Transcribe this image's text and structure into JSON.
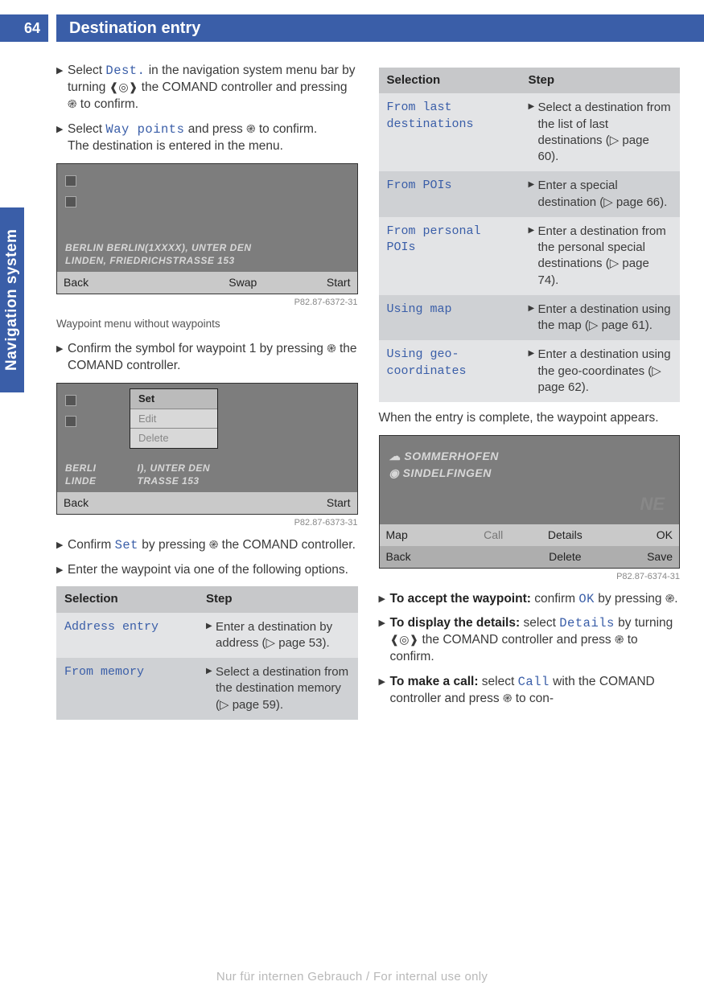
{
  "page": {
    "number": "64",
    "title": "Destination entry",
    "side_tab": "Navigation system"
  },
  "steps": {
    "s1a": "Select ",
    "s1term": "Dest.",
    "s1b": " in the navigation system menu bar by turning ",
    "s1c": " the COMAND controller and pressing ",
    "s1d": " to confirm.",
    "s2a": "Select ",
    "s2term": "Way points",
    "s2b": " and press ",
    "s2c": " to confirm.",
    "s2d": "The destination is entered in the menu.",
    "s3": "Confirm the symbol for waypoint 1 by pressing ",
    "s3b": " the COMAND controller.",
    "s4a": "Confirm ",
    "s4term": "Set",
    "s4b": " by pressing ",
    "s4c": " the COMAND controller.",
    "s5": "Enter the waypoint via one of the following options."
  },
  "shot1": {
    "addr1": "BERLIN BERLIN(1XXXX), UNTER DEN",
    "addr2": "LINDEN, FRIEDRICHSTRASSE 153",
    "bar": [
      "Back",
      "",
      "Swap",
      "Start"
    ],
    "id": "P82.87-6372-31",
    "caption": "Waypoint menu without waypoints"
  },
  "shot2": {
    "popup": [
      "Set",
      "Edit",
      "Delete"
    ],
    "addr1": "BERLI",
    "addr1b": "I), UNTER DEN",
    "addr2": "LINDE",
    "addr2b": "TRASSE 153",
    "bar": [
      "Back",
      "",
      "",
      "Start"
    ],
    "id": "P82.87-6373-31"
  },
  "table_head": {
    "c1": "Selection",
    "c2": "Step"
  },
  "table1": [
    {
      "sel": "Address entry",
      "step": "Enter a destination by address (▷ page 53)."
    },
    {
      "sel": "From memory",
      "step": "Select a destination from the destination memory (▷ page 59)."
    }
  ],
  "table2": [
    {
      "sel": "From last destinations",
      "step": "Select a destination from the list of last destinations (▷ page 60)."
    },
    {
      "sel": "From POIs",
      "step": "Enter a special destination (▷ page 66)."
    },
    {
      "sel": "From personal POIs",
      "step": "Enter a destination from the personal special destinations (▷ page 74)."
    },
    {
      "sel": "Using map",
      "step": "Enter a destination using the map (▷ page 61)."
    },
    {
      "sel": "Using geo-coordinates",
      "step": "Enter a destination using the geo-coordinates (▷ page 62)."
    }
  ],
  "after_table": "When the entry is complete, the waypoint appears.",
  "shot3": {
    "l1": "SOMMERHOFEN",
    "l2": "SINDELFINGEN",
    "ne": "NE",
    "bar1": [
      "Map",
      "Call",
      "Details",
      "OK"
    ],
    "bar2": [
      "Back",
      "",
      "Delete",
      "Save"
    ],
    "id": "P82.87-6374-31"
  },
  "final": {
    "f1a": "To accept the waypoint:",
    "f1b": " confirm ",
    "f1term": "OK",
    "f1c": " by pressing ",
    "f1d": ".",
    "f2a": "To display the details:",
    "f2b": " select ",
    "f2term": "Details",
    "f2c": " by turning ",
    "f2d": " the COMAND controller and press ",
    "f2e": " to confirm.",
    "f3a": "To make a call:",
    "f3b": " select ",
    "f3term": "Call",
    "f3c": " with the COMAND controller and press ",
    "f3d": " to con-"
  },
  "glyphs": {
    "turn": "❰◎❱",
    "press": "֎"
  },
  "footer": "Nur für internen Gebrauch / For internal use only"
}
